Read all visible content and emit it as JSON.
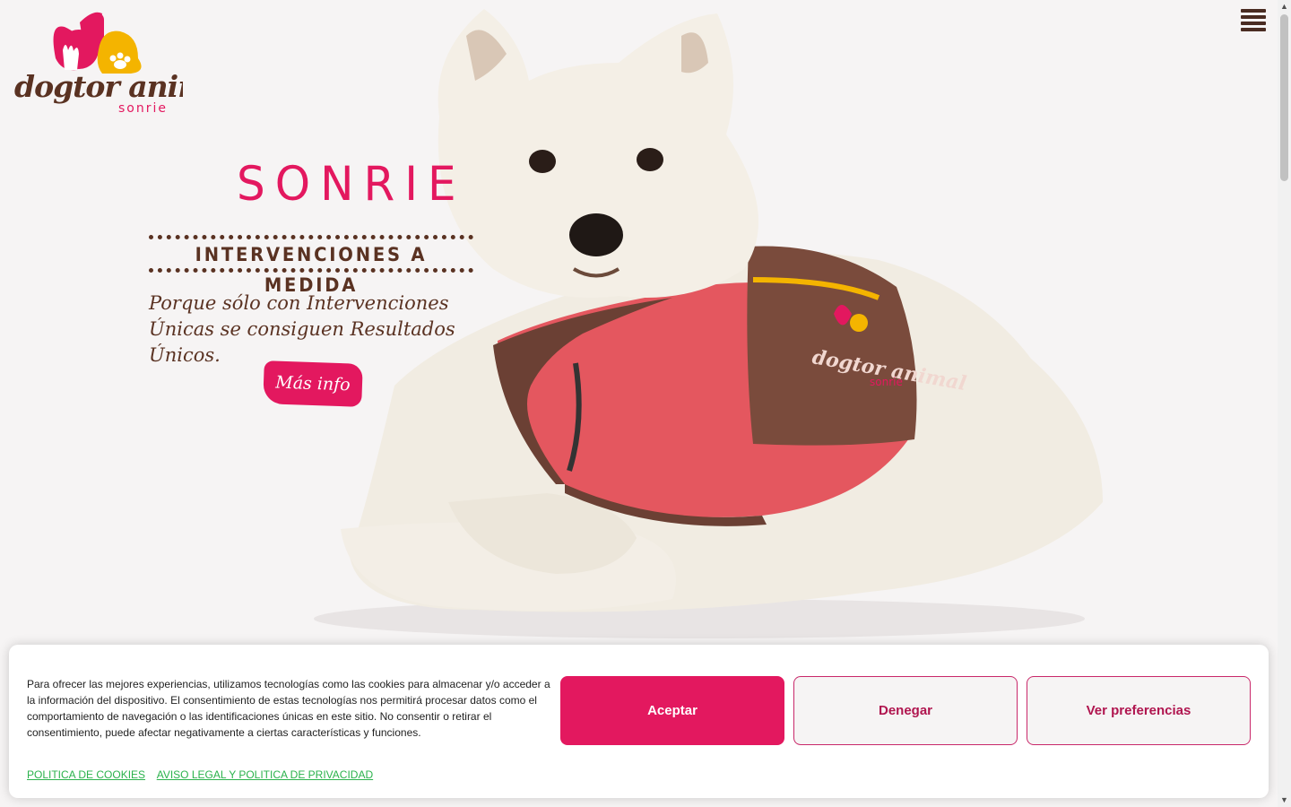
{
  "logo": {
    "brand": "dogtor animal",
    "tagline": "sonrie",
    "colors": {
      "pink": "#e3185f",
      "yellow": "#f4b400",
      "brown": "#5a3222"
    }
  },
  "header": {
    "menu_icon": "hamburger-menu-icon"
  },
  "hero": {
    "title": "SONRIE",
    "banner": "INTERVENCIONES A MEDIDA",
    "lead": "Porque sólo con Intervenciones Únicas se consiguen Resultados Únicos.",
    "cta_label": "Más info",
    "coat_brand": "dogtor animal",
    "coat_tagline": "sonrie"
  },
  "cookie": {
    "message": "Para ofrecer las mejores experiencias, utilizamos tecnologías como las cookies para almacenar y/o acceder a la información del dispositivo. El consentimiento de estas tecnologías nos permitirá procesar datos como el comportamiento de navegación o las identificaciones únicas en este sitio. No consentir o retirar el consentimiento, puede afectar negativamente a ciertas características y funciones.",
    "accept_label": "Aceptar",
    "deny_label": "Denegar",
    "prefs_label": "Ver preferencias",
    "links": [
      "POLITICA DE COOKIES",
      "AVISO LEGAL Y POLITICA DE PRIVACIDAD"
    ]
  },
  "theme": {
    "accent": "#e3185f",
    "text_brown": "#5a3222",
    "link_green": "#2bb24c",
    "background": "#f6f4f4"
  }
}
